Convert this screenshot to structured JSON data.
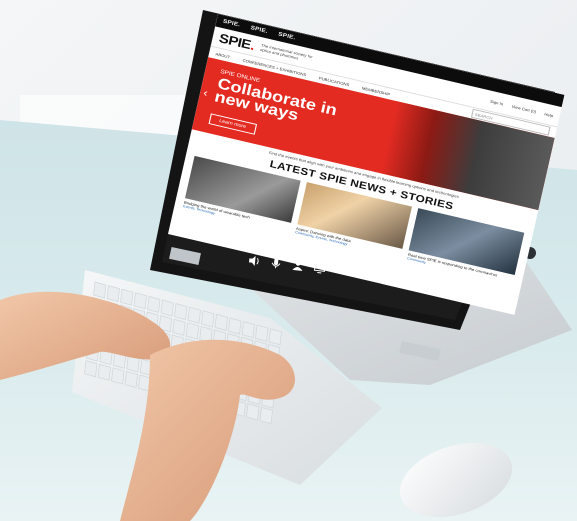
{
  "screen": {
    "topbar_tabs": [
      "SPIE.",
      "SPIE.",
      "SPIE."
    ],
    "logo_text": "SPIE",
    "tagline": "The international society for optics and photonics",
    "header_links": [
      "Sign In",
      "View Cart (0)",
      "Help"
    ],
    "nav_items": [
      "About",
      "Conferences + Exhibitions",
      "Publications",
      "Membership",
      "Industry Resources",
      "Education",
      "News"
    ],
    "search_placeholder": "Search",
    "hero": {
      "label": "SPIE ONLINE",
      "headline": "Collaborate in new ways",
      "button": "Learn more"
    },
    "blurb": "Find the events that align with your ambitions and engage in flexible learning options and technologies",
    "section_title": "LATEST SPIE NEWS + STORIES",
    "cards": [
      {
        "caption": "Bridging the world of wearable tech",
        "tag": "Events, Technology"
      },
      {
        "caption": "Aspire: Dancing with the data",
        "tag": "Community, Events, Technology"
      },
      {
        "caption": "Real time SPIE is responding to the coronavirus",
        "tag": "Community"
      }
    ]
  },
  "dock_icons": [
    "speaker-icon",
    "microphone-icon",
    "person-icon",
    "screen-icon",
    "camera-icon"
  ]
}
